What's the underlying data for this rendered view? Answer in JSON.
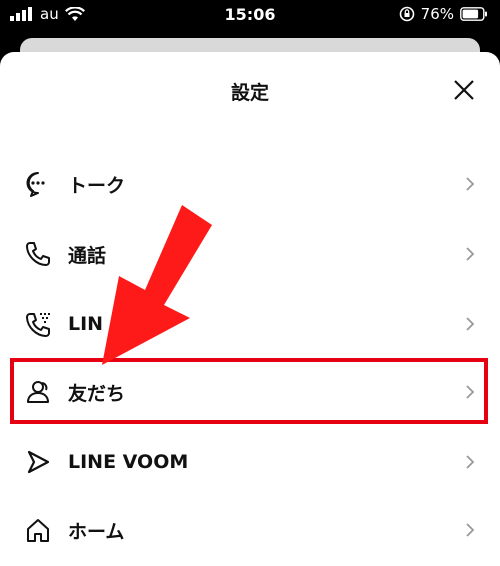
{
  "status_bar": {
    "carrier": "au",
    "time": "15:06",
    "battery": "76%",
    "icons": [
      "signal-icon",
      "wifi-icon",
      "orientation-lock-icon",
      "battery-icon"
    ]
  },
  "sheet": {
    "title": "設定",
    "close_icon": "close-icon"
  },
  "menu": {
    "items": [
      {
        "label": "トーク",
        "icon": "chat-bubble-icon"
      },
      {
        "label": "通話",
        "icon": "phone-icon"
      },
      {
        "label": "LIN",
        "icon": "line-out-icon"
      },
      {
        "label": "友だち",
        "icon": "friends-icon"
      },
      {
        "label": "LINE VOOM",
        "icon": "voom-icon"
      },
      {
        "label": "ホーム",
        "icon": "home-icon"
      }
    ]
  },
  "colors": {
    "highlight": "#e50012",
    "arrow": "#ff1a1a",
    "text": "#111111",
    "chevron": "#999999"
  }
}
